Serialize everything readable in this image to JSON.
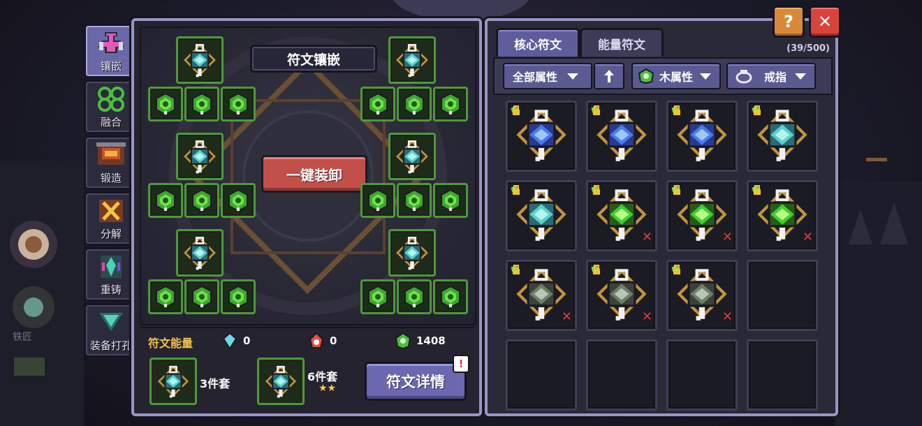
{
  "side_tabs": [
    {
      "label": "镶嵌",
      "icon": "inlay-icon",
      "active": true
    },
    {
      "label": "融合",
      "icon": "fusion-icon",
      "active": false
    },
    {
      "label": "锻造",
      "icon": "forge-icon",
      "active": false
    },
    {
      "label": "分解",
      "icon": "decompose-icon",
      "active": false
    },
    {
      "label": "重铸",
      "icon": "recast-icon",
      "active": false
    },
    {
      "label": "装备打孔",
      "icon": "socket-drill-icon",
      "active": false
    }
  ],
  "background": {
    "npc_label": "铁匠"
  },
  "left_panel": {
    "title": "符文镶嵌",
    "unequip_button": "一键装卸",
    "energy": {
      "label": "符文能量",
      "blue": "0",
      "red": "0",
      "green": "1408"
    },
    "sets": [
      {
        "label": "3件套",
        "stars": ""
      },
      {
        "label": "6件套",
        "stars": "★★"
      }
    ],
    "detail_button": "符文详情",
    "notice": "!"
  },
  "right_panel": {
    "tabs": [
      "核心符文",
      "能量符文"
    ],
    "active_tab": 0,
    "count": "(39/500)",
    "filters": {
      "attribute": "全部属性",
      "sort_icon": "up-arrow-icon",
      "element": "木属性",
      "slot": "戒指"
    },
    "grid": [
      {
        "type": "blue-core",
        "locked": true,
        "unequippable": false
      },
      {
        "type": "blue-core",
        "locked": true,
        "unequippable": false
      },
      {
        "type": "blue-core",
        "locked": true,
        "unequippable": false
      },
      {
        "type": "teal-core",
        "locked": true,
        "unequippable": false
      },
      {
        "type": "teal-core",
        "locked": true,
        "unequippable": false
      },
      {
        "type": "green-core",
        "locked": true,
        "unequippable": true
      },
      {
        "type": "green-core",
        "locked": true,
        "unequippable": true
      },
      {
        "type": "green-core",
        "locked": true,
        "unequippable": true
      },
      {
        "type": "gray-core",
        "locked": true,
        "unequippable": true
      },
      {
        "type": "gray-core",
        "locked": true,
        "unequippable": true
      },
      {
        "type": "gray-core",
        "locked": true,
        "unequippable": true
      },
      {
        "type": "empty"
      },
      {
        "type": "empty"
      },
      {
        "type": "empty"
      },
      {
        "type": "empty"
      },
      {
        "type": "empty"
      }
    ]
  },
  "buttons": {
    "help": "?",
    "close": "✕"
  },
  "colors": {
    "panel_border": "#9896c4",
    "slot_border": "#4e9a36",
    "unequip": "#c24f4a",
    "accent_purple": "#6b68b0",
    "energy_label": "#f1c24b"
  }
}
